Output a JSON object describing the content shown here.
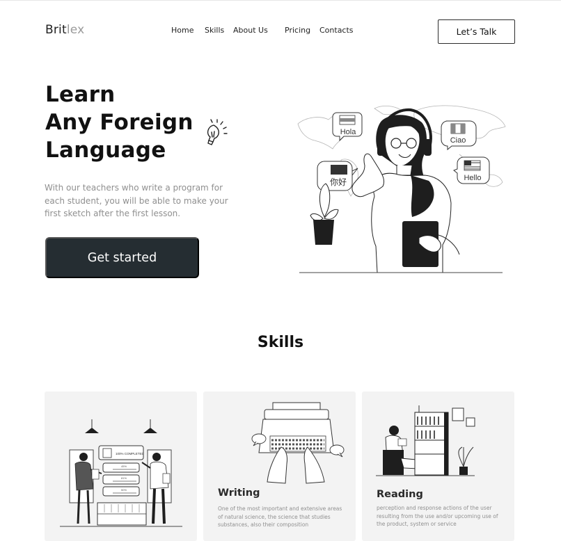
{
  "header": {
    "logo_part1": "Brit",
    "logo_part2": "lex",
    "nav": [
      {
        "label": "Home"
      },
      {
        "label": "Skills"
      },
      {
        "label": "About Us"
      },
      {
        "label": "Pricing"
      },
      {
        "label": "Contacts"
      }
    ],
    "cta_label": "Let’s Talk"
  },
  "hero": {
    "title_lines": [
      "Learn",
      "Any Foreign",
      "Language"
    ],
    "subtitle": "With our teachers who write a program for each student, you will be able to make your first sketch after the first lesson.",
    "button_label": "Get started",
    "bubbles": [
      {
        "text": "Hola"
      },
      {
        "text": "Ciao"
      },
      {
        "text": "你好"
      },
      {
        "text": "Hello"
      }
    ]
  },
  "skills": {
    "title": "Skills",
    "progress_label": "100% COMPLETED",
    "progress_items": [
      "45%",
      "81%",
      "50%"
    ],
    "cards": [
      {
        "title": "",
        "description": ""
      },
      {
        "title": "Writing",
        "description": "One of the most important and extensive areas of natural science, the science that studies substances, also their composition"
      },
      {
        "title": "Reading",
        "description": "perception and response actions of the user resulting from the use and/or upcoming use of the product, system or service"
      }
    ]
  },
  "colors": {
    "button_dark": "#252d32",
    "card_bg": "#f3f3f3",
    "muted_text": "#8f8f8f"
  }
}
